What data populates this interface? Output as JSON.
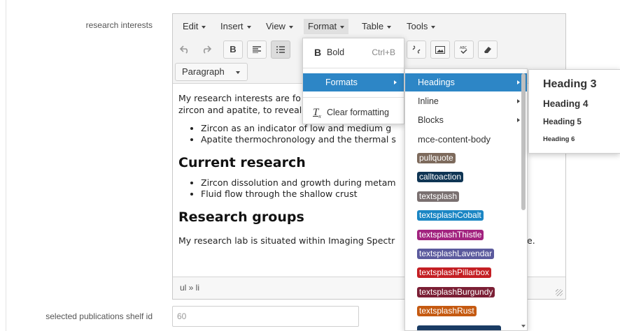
{
  "fields": {
    "research_interests_label": "research interests",
    "publications_label": "selected publications shelf id",
    "publications_value": "60"
  },
  "menubar": {
    "edit": "Edit",
    "insert": "Insert",
    "view": "View",
    "format": "Format",
    "table": "Table",
    "tools": "Tools"
  },
  "toolbar": {
    "block_format": "Paragraph",
    "bold_glyph": "B"
  },
  "content": {
    "intro_visible": "My research interests are fo",
    "intro_line2_visible": "zircon and apatite, to reveal",
    "bullets1": [
      "Zircon as an indicator of low and medium g",
      "Apatite thermochronology and the thermal s"
    ],
    "heading1": "Current research",
    "bullets2": [
      "Zircon dissolution and growth during metam",
      "Fluid flow through the shallow crust"
    ],
    "heading2": "Research groups",
    "lab_text_visible": "My research lab is situated within Imaging Spectr",
    "lab_text_tail": "e."
  },
  "statusbar": {
    "path": "ul » li"
  },
  "format_menu": {
    "bold": "Bold",
    "bold_shortcut": "Ctrl+B",
    "formats": "Formats",
    "clear_formatting": "Clear formatting"
  },
  "formats_menu": {
    "headings": "Headings",
    "inline": "Inline",
    "blocks": "Blocks",
    "body_class": "mce-content-body",
    "styles": [
      {
        "label": "pullquote",
        "color": "#7d6a5c"
      },
      {
        "label": "calltoaction",
        "color": "#0f3554"
      },
      {
        "label": "textsplash",
        "color": "#7a7070"
      },
      {
        "label": "textsplashCobalt",
        "color": "#1b86c4"
      },
      {
        "label": "textsplashThistle",
        "color": "#a2237f"
      },
      {
        "label": "textsplashLavendar",
        "color": "#5b5a9d"
      },
      {
        "label": "textsplashPillarbox",
        "color": "#c41f24"
      },
      {
        "label": "textsplashBurgundy",
        "color": "#7b1f35"
      },
      {
        "label": "textsplashRust",
        "color": "#c55a11"
      }
    ]
  },
  "headings_menu": {
    "h3": "Heading 3",
    "h4": "Heading 4",
    "h5": "Heading 5",
    "h6": "Heading 6"
  },
  "colors": {
    "selected_item": "#2d86c6",
    "menubar_bg": "#f3f3f3"
  }
}
